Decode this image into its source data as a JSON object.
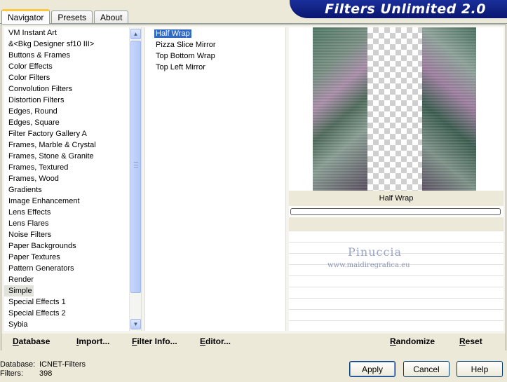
{
  "tabs": [
    {
      "label": "Navigator",
      "active": true
    },
    {
      "label": "Presets",
      "active": false
    },
    {
      "label": "About",
      "active": false
    }
  ],
  "banner": {
    "title": "Filters Unlimited 2.0"
  },
  "categories": [
    " VM Instant Art",
    "&<Bkg Designer sf10 III>",
    "Buttons & Frames",
    "Color Effects",
    "Color Filters",
    "Convolution Filters",
    "Distortion Filters",
    "Edges, Round",
    "Edges, Square",
    "Filter Factory Gallery A",
    "Frames, Marble & Crystal",
    "Frames, Stone & Granite",
    "Frames, Textured",
    "Frames, Wood",
    "Gradients",
    "Image Enhancement",
    "Lens Effects",
    "Lens Flares",
    "Noise Filters",
    "Paper Backgrounds",
    "Paper Textures",
    "Pattern Generators",
    "Render",
    "Simple",
    "Special Effects 1",
    "Special Effects 2",
    "Sybia"
  ],
  "selected_category": "Simple",
  "filters": [
    "Half Wrap",
    "Pizza Slice Mirror",
    "Top Bottom Wrap",
    "Top Left Mirror"
  ],
  "selected_filter": "Half Wrap",
  "preview": {
    "caption": "Half Wrap",
    "watermark_name": "Pinuccia",
    "watermark_url": "www.maidiregrafica.eu"
  },
  "links": {
    "database": "Database",
    "import": "Import...",
    "filter_info": "Filter Info...",
    "editor": "Editor...",
    "randomize": "Randomize",
    "reset": "Reset"
  },
  "footer": {
    "database_label": "Database:",
    "database_value": "ICNET-Filters",
    "filters_label": "Filters:",
    "filters_value": "398"
  },
  "buttons": {
    "apply": "Apply",
    "cancel": "Cancel",
    "help": "Help"
  },
  "colors": {
    "banner": "#0a1670",
    "selection": "#316ac5",
    "dialog_bg": "#ece9d8"
  },
  "icons": {
    "scroll_up": "chevron-up-icon",
    "scroll_down": "chevron-down-icon"
  }
}
